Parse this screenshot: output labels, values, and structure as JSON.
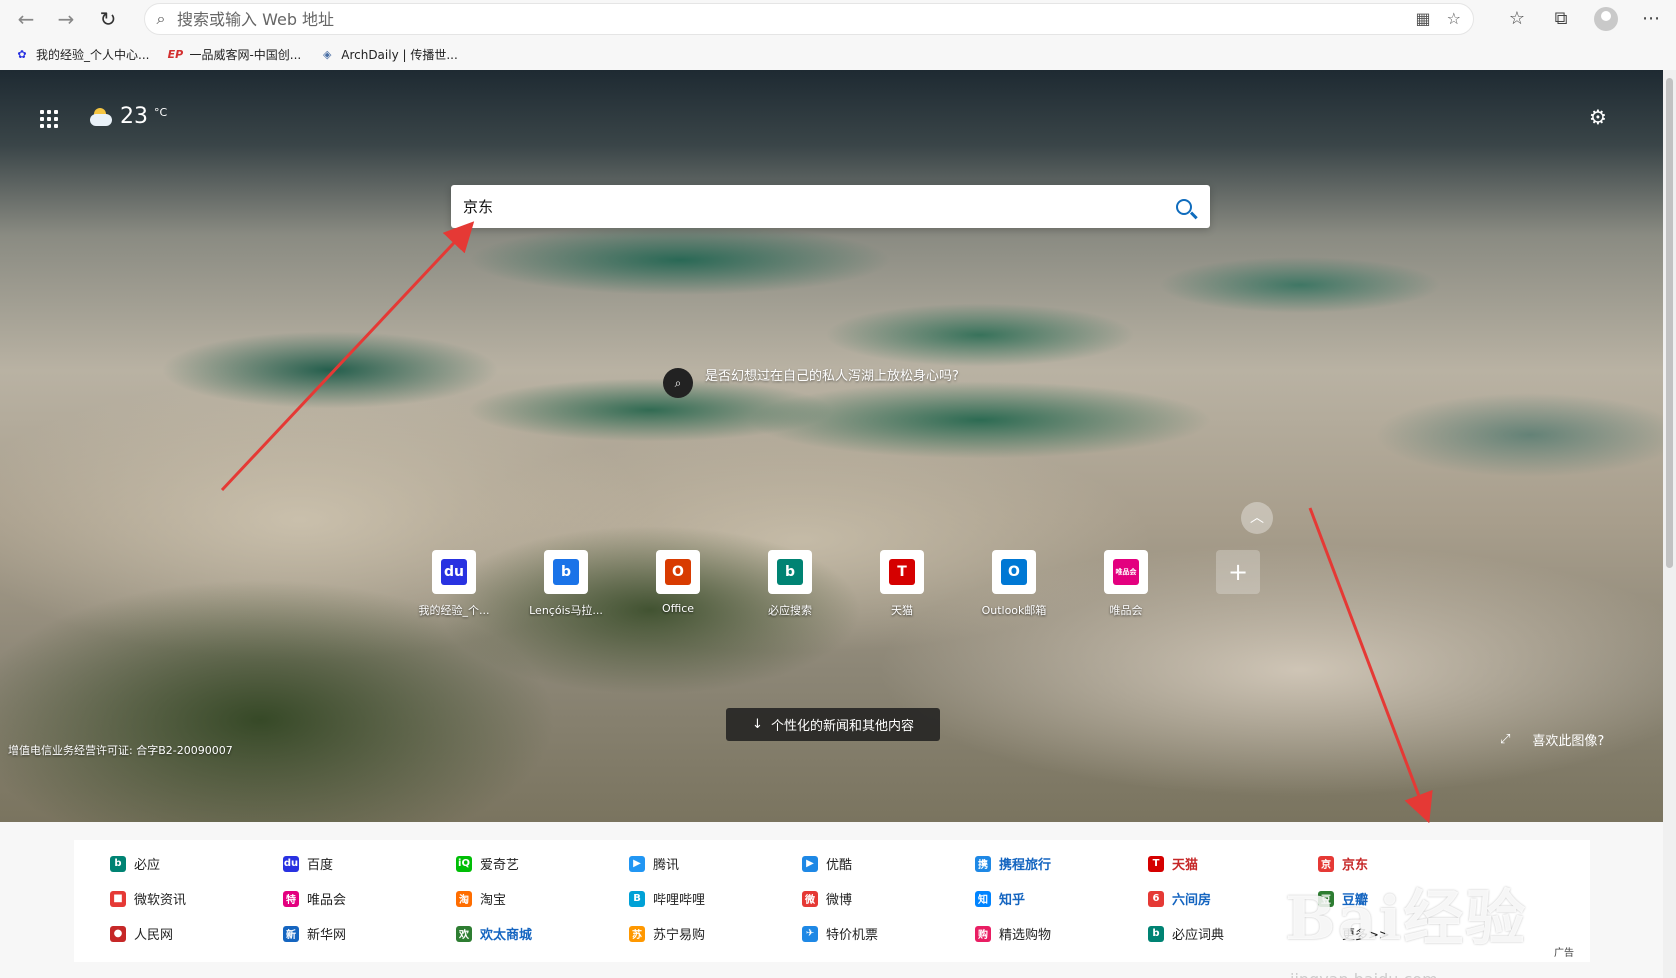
{
  "browser": {
    "address_placeholder": "搜索或输入 Web 地址",
    "bookmarks": [
      {
        "label": "我的经验_个人中心...",
        "icon": "baidu-paw-icon",
        "color": "#2932e1"
      },
      {
        "label": "一品威客网-中国创...",
        "icon": "ep-icon",
        "color": "#d32f2f"
      },
      {
        "label": "ArchDaily | 传播世...",
        "icon": "archdaily-icon",
        "color": "#4a6fa5"
      }
    ]
  },
  "hero": {
    "temperature": "23",
    "temp_unit": "°C",
    "search_value": "京东",
    "discover_text": "是否幻想过在自己的私人泻湖上放松身心吗?",
    "news_button": "个性化的新闻和其他内容",
    "license": "增值电信业务经营许可证: 合字B2-20090007",
    "like_text": "喜欢此图像?"
  },
  "tiles": [
    {
      "label": "我的经验_个...",
      "glyph": "du",
      "color": "#2932e1",
      "icon": "baidu-icon"
    },
    {
      "label": "Lençóis马拉...",
      "glyph": "b",
      "color": "#1a73e8",
      "icon": "bing-icon"
    },
    {
      "label": "Office",
      "glyph": "O",
      "color": "#d83b01",
      "icon": "office-icon"
    },
    {
      "label": "必应搜索",
      "glyph": "b",
      "color": "#008373",
      "icon": "bing-search-icon"
    },
    {
      "label": "天猫",
      "glyph": "T",
      "color": "#d50000",
      "icon": "tmall-icon"
    },
    {
      "label": "Outlook邮箱",
      "glyph": "O",
      "color": "#0078d4",
      "icon": "outlook-icon"
    },
    {
      "label": "唯品会",
      "glyph": "唯品会",
      "color": "#e3007f",
      "icon": "vipshop-icon"
    }
  ],
  "links": [
    {
      "label": "必应",
      "glyph": "b",
      "color": "#008373",
      "style": ""
    },
    {
      "label": "微软资讯",
      "glyph": "■",
      "color": "#e53935",
      "style": ""
    },
    {
      "label": "人民网",
      "glyph": "●",
      "color": "#c62828",
      "style": ""
    },
    {
      "label": "百度",
      "glyph": "du",
      "color": "#2932e1",
      "style": ""
    },
    {
      "label": "唯品会",
      "glyph": "特",
      "color": "#e3007f",
      "style": ""
    },
    {
      "label": "新华网",
      "glyph": "新",
      "color": "#1565c0",
      "style": ""
    },
    {
      "label": "爱奇艺",
      "glyph": "iQ",
      "color": "#00be06",
      "style": ""
    },
    {
      "label": "淘宝",
      "glyph": "淘",
      "color": "#ff6d00",
      "style": ""
    },
    {
      "label": "欢太商城",
      "glyph": "欢",
      "color": "#2e7d32",
      "style": "blue"
    },
    {
      "label": "腾讯",
      "glyph": "▶",
      "color": "#2196f3",
      "style": ""
    },
    {
      "label": "哔哩哔哩",
      "glyph": "B",
      "color": "#00a1d6",
      "style": ""
    },
    {
      "label": "苏宁易购",
      "glyph": "苏",
      "color": "#ff9800",
      "style": ""
    },
    {
      "label": "优酷",
      "glyph": "▶",
      "color": "#1e88e5",
      "style": ""
    },
    {
      "label": "微博",
      "glyph": "微",
      "color": "#e53935",
      "style": ""
    },
    {
      "label": "特价机票",
      "glyph": "✈",
      "color": "#1e88e5",
      "style": ""
    },
    {
      "label": "携程旅行",
      "glyph": "携",
      "color": "#1e88e5",
      "style": "blue"
    },
    {
      "label": "知乎",
      "glyph": "知",
      "color": "#0084ff",
      "style": "blue"
    },
    {
      "label": "精选购物",
      "glyph": "购",
      "color": "#e91e63",
      "style": ""
    },
    {
      "label": "天猫",
      "glyph": "T",
      "color": "#d50000",
      "style": "red"
    },
    {
      "label": "六间房",
      "glyph": "6",
      "color": "#e53935",
      "style": "blue"
    },
    {
      "label": "必应词典",
      "glyph": "b",
      "color": "#008373",
      "style": ""
    },
    {
      "label": "京东",
      "glyph": "京",
      "color": "#e53935",
      "style": "red"
    },
    {
      "label": "豆瓣",
      "glyph": "豆",
      "color": "#2e7d32",
      "style": "blue"
    },
    {
      "label": "更多>>",
      "glyph": "",
      "color": "#888888",
      "style": ""
    }
  ],
  "ad_label": "广告",
  "watermark": {
    "brand": "Bai经验",
    "url": "jingyan.baidu.com"
  }
}
